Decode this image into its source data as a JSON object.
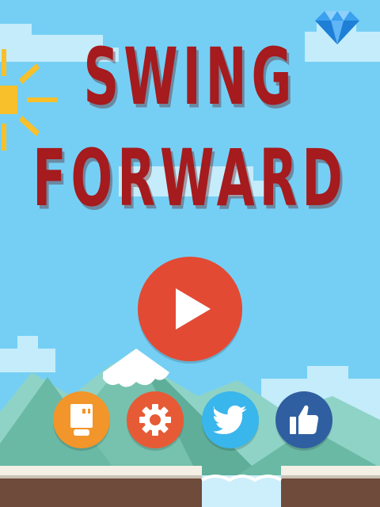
{
  "title": {
    "line1": "SWING",
    "line2": "FORWARD"
  },
  "buttons": {
    "play": {
      "icon": "play-icon"
    },
    "profile": {
      "icon": "character-icon"
    },
    "settings": {
      "icon": "gear-icon"
    },
    "twitter": {
      "icon": "twitter-bird-icon"
    },
    "like": {
      "icon": "thumbs-up-icon"
    }
  },
  "store": {
    "icon": "diamond-icon"
  },
  "colors": {
    "sky": "#75cff4",
    "title": "#a51b1e",
    "play": "#e34a34",
    "profile": "#f2952a",
    "settings": "#e75a36",
    "twitter": "#39b6ec",
    "like": "#2f5fa0",
    "sun": "#f8c02a"
  }
}
